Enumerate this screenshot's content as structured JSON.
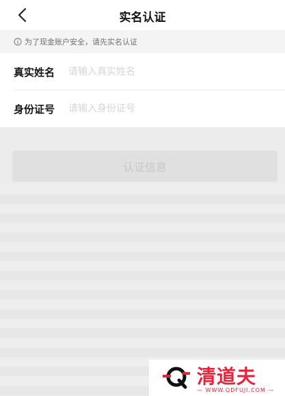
{
  "header": {
    "title": "实名认证"
  },
  "notice": {
    "text": "为了现金账户安全，请先实名认证"
  },
  "form": {
    "name_label": "真实姓名",
    "name_placeholder": "请输入真实姓名",
    "name_value": "",
    "id_label": "身份证号",
    "id_placeholder": "请输入身份证号",
    "id_value": ""
  },
  "submit": {
    "label": "认证信息"
  },
  "watermark": {
    "brand": "清道夫",
    "site": "— WWW.QDFUJI.COM —"
  },
  "colors": {
    "brand_red": "#e3243b",
    "disabled_button": "#e0e0e0",
    "page_bg": "#ececec"
  }
}
